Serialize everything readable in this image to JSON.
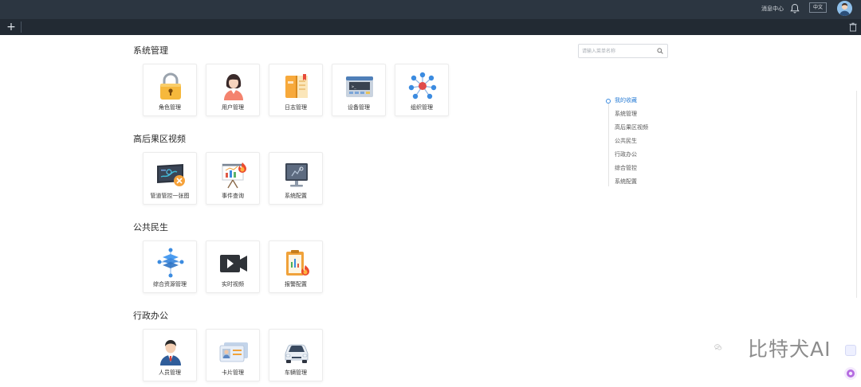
{
  "header": {
    "message_center": "消息中心",
    "language": "中文",
    "bell_icon": "bell-icon",
    "avatar_icon": "user-avatar"
  },
  "tabbar": {
    "add_label": "+",
    "trash_icon": "trash-icon"
  },
  "search": {
    "placeholder": "请输入菜单名称"
  },
  "sections": [
    {
      "title": "系统管理",
      "cards": [
        {
          "label": "角色管理",
          "icon": "padlock-icon"
        },
        {
          "label": "用户管理",
          "icon": "user-woman-icon"
        },
        {
          "label": "日志管理",
          "icon": "notebook-icon"
        },
        {
          "label": "设备管理",
          "icon": "device-terminal-icon"
        },
        {
          "label": "组织管理",
          "icon": "org-network-icon"
        }
      ]
    },
    {
      "title": "高后果区视频",
      "cards": [
        {
          "label": "管道管控一张图",
          "icon": "pipeline-map-icon"
        },
        {
          "label": "事件查询",
          "icon": "event-chart-icon"
        },
        {
          "label": "系统配置",
          "icon": "monitor-config-icon"
        }
      ]
    },
    {
      "title": "公共民生",
      "cards": [
        {
          "label": "综合资源管理",
          "icon": "resource-layers-icon"
        },
        {
          "label": "实时视频",
          "icon": "video-camera-icon"
        },
        {
          "label": "报警配置",
          "icon": "alarm-clipboard-icon"
        }
      ]
    },
    {
      "title": "行政办公",
      "cards": [
        {
          "label": "人员管理",
          "icon": "person-suit-icon"
        },
        {
          "label": "卡片管理",
          "icon": "id-card-icon"
        },
        {
          "label": "车辆管理",
          "icon": "car-icon"
        }
      ]
    }
  ],
  "anchor_nav": {
    "items": [
      "我的收藏",
      "系统管理",
      "高后果区视频",
      "公共民生",
      "行政办公",
      "综合管控",
      "系统配置"
    ],
    "active_index": 0
  },
  "watermark": {
    "text": "比特犬AI"
  },
  "colors": {
    "topbar": "#2c3641",
    "tabbar": "#222a33",
    "accent": "#2d7fd6"
  }
}
